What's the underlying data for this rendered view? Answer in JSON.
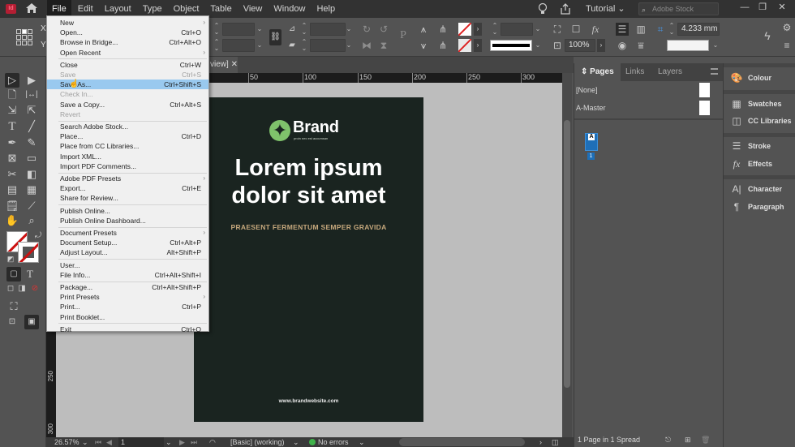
{
  "app": {
    "logo": "Id",
    "workspace": "Tutorial",
    "stock_placeholder": "Adobe Stock"
  },
  "menubar": {
    "items": [
      "File",
      "Edit",
      "Layout",
      "Type",
      "Object",
      "Table",
      "View",
      "Window",
      "Help"
    ],
    "active": "File"
  },
  "controlbar": {
    "x_label": "X:",
    "y_label": "Y:",
    "scale_percent": "100%",
    "stroke_weight": "4.233 mm"
  },
  "document": {
    "tab_title": "view]",
    "ruler_ticks": [
      "50",
      "100",
      "150",
      "200",
      "250",
      "300"
    ],
    "vruler_ticks": [
      "250",
      "300"
    ]
  },
  "page": {
    "brand_name": "Brand",
    "brand_tagline": "proin nec est accumsan",
    "headline_1": "Lorem ipsum",
    "headline_2": "dolor sit amet",
    "subline": "PRAESENT FERMENTUM SEMPER GRAVIDA",
    "website": "www.brandwebsite.com",
    "colors": {
      "background": "#1a2420",
      "logo": "#7fc26b",
      "accent": "#c7a97d"
    }
  },
  "file_menu": {
    "items": [
      {
        "label": "New",
        "shortcut": "",
        "submenu": true,
        "disabled": false
      },
      {
        "label": "Open...",
        "shortcut": "Ctrl+O",
        "disabled": false
      },
      {
        "label": "Browse in Bridge...",
        "shortcut": "Ctrl+Alt+O",
        "disabled": false
      },
      {
        "label": "Open Recent",
        "shortcut": "",
        "submenu": true,
        "disabled": false
      },
      {
        "label": "Close",
        "shortcut": "Ctrl+W",
        "disabled": false
      },
      {
        "label": "Save",
        "shortcut": "Ctrl+S",
        "disabled": true
      },
      {
        "label": "Save As...",
        "shortcut": "Ctrl+Shift+S",
        "disabled": false,
        "highlighted": true
      },
      {
        "label": "Check In...",
        "shortcut": "",
        "disabled": true
      },
      {
        "label": "Save a Copy...",
        "shortcut": "Ctrl+Alt+S",
        "disabled": false
      },
      {
        "label": "Revert",
        "shortcut": "",
        "disabled": true
      },
      {
        "label": "Search Adobe Stock...",
        "shortcut": "",
        "disabled": false
      },
      {
        "label": "Place...",
        "shortcut": "Ctrl+D",
        "disabled": false
      },
      {
        "label": "Place from CC Libraries...",
        "shortcut": "",
        "disabled": false
      },
      {
        "label": "Import XML...",
        "shortcut": "",
        "disabled": false
      },
      {
        "label": "Import PDF Comments...",
        "shortcut": "",
        "disabled": false
      },
      {
        "label": "Adobe PDF Presets",
        "shortcut": "",
        "submenu": true,
        "disabled": false
      },
      {
        "label": "Export...",
        "shortcut": "Ctrl+E",
        "disabled": false
      },
      {
        "label": "Share for Review...",
        "shortcut": "",
        "disabled": false
      },
      {
        "label": "Publish Online...",
        "shortcut": "",
        "disabled": false
      },
      {
        "label": "Publish Online Dashboard...",
        "shortcut": "",
        "disabled": false
      },
      {
        "label": "Document Presets",
        "shortcut": "",
        "submenu": true,
        "disabled": false
      },
      {
        "label": "Document Setup...",
        "shortcut": "Ctrl+Alt+P",
        "disabled": false
      },
      {
        "label": "Adjust Layout...",
        "shortcut": "Alt+Shift+P",
        "disabled": false
      },
      {
        "label": "User...",
        "shortcut": "",
        "disabled": false
      },
      {
        "label": "File Info...",
        "shortcut": "Ctrl+Alt+Shift+I",
        "disabled": false
      },
      {
        "label": "Package...",
        "shortcut": "Ctrl+Alt+Shift+P",
        "disabled": false
      },
      {
        "label": "Print Presets",
        "shortcut": "",
        "submenu": true,
        "disabled": false
      },
      {
        "label": "Print...",
        "shortcut": "Ctrl+P",
        "disabled": false
      },
      {
        "label": "Print Booklet...",
        "shortcut": "",
        "disabled": false
      },
      {
        "label": "Exit",
        "shortcut": "Ctrl+Q",
        "disabled": false
      }
    ]
  },
  "pages_panel": {
    "tabs": [
      "Pages",
      "Links",
      "Layers"
    ],
    "active_tab": "Pages",
    "masters": [
      "[None]",
      "A-Master"
    ],
    "page_thumb_label": "A",
    "page_number": "1",
    "footer": "1 Page in 1 Spread"
  },
  "dock": {
    "items": [
      {
        "label": "Colour",
        "icon": "palette-icon"
      },
      {
        "label": "Swatches",
        "icon": "swatches-icon"
      },
      {
        "label": "CC Libraries",
        "icon": "cc-libraries-icon"
      },
      {
        "label": "Stroke",
        "icon": "stroke-icon"
      },
      {
        "label": "Effects",
        "icon": "fx-icon"
      },
      {
        "label": "Character",
        "icon": "character-icon"
      },
      {
        "label": "Paragraph",
        "icon": "paragraph-icon"
      }
    ]
  },
  "statusbar": {
    "zoom": "26.57%",
    "page": "1",
    "style": "[Basic] (working)",
    "preflight": "No errors"
  }
}
